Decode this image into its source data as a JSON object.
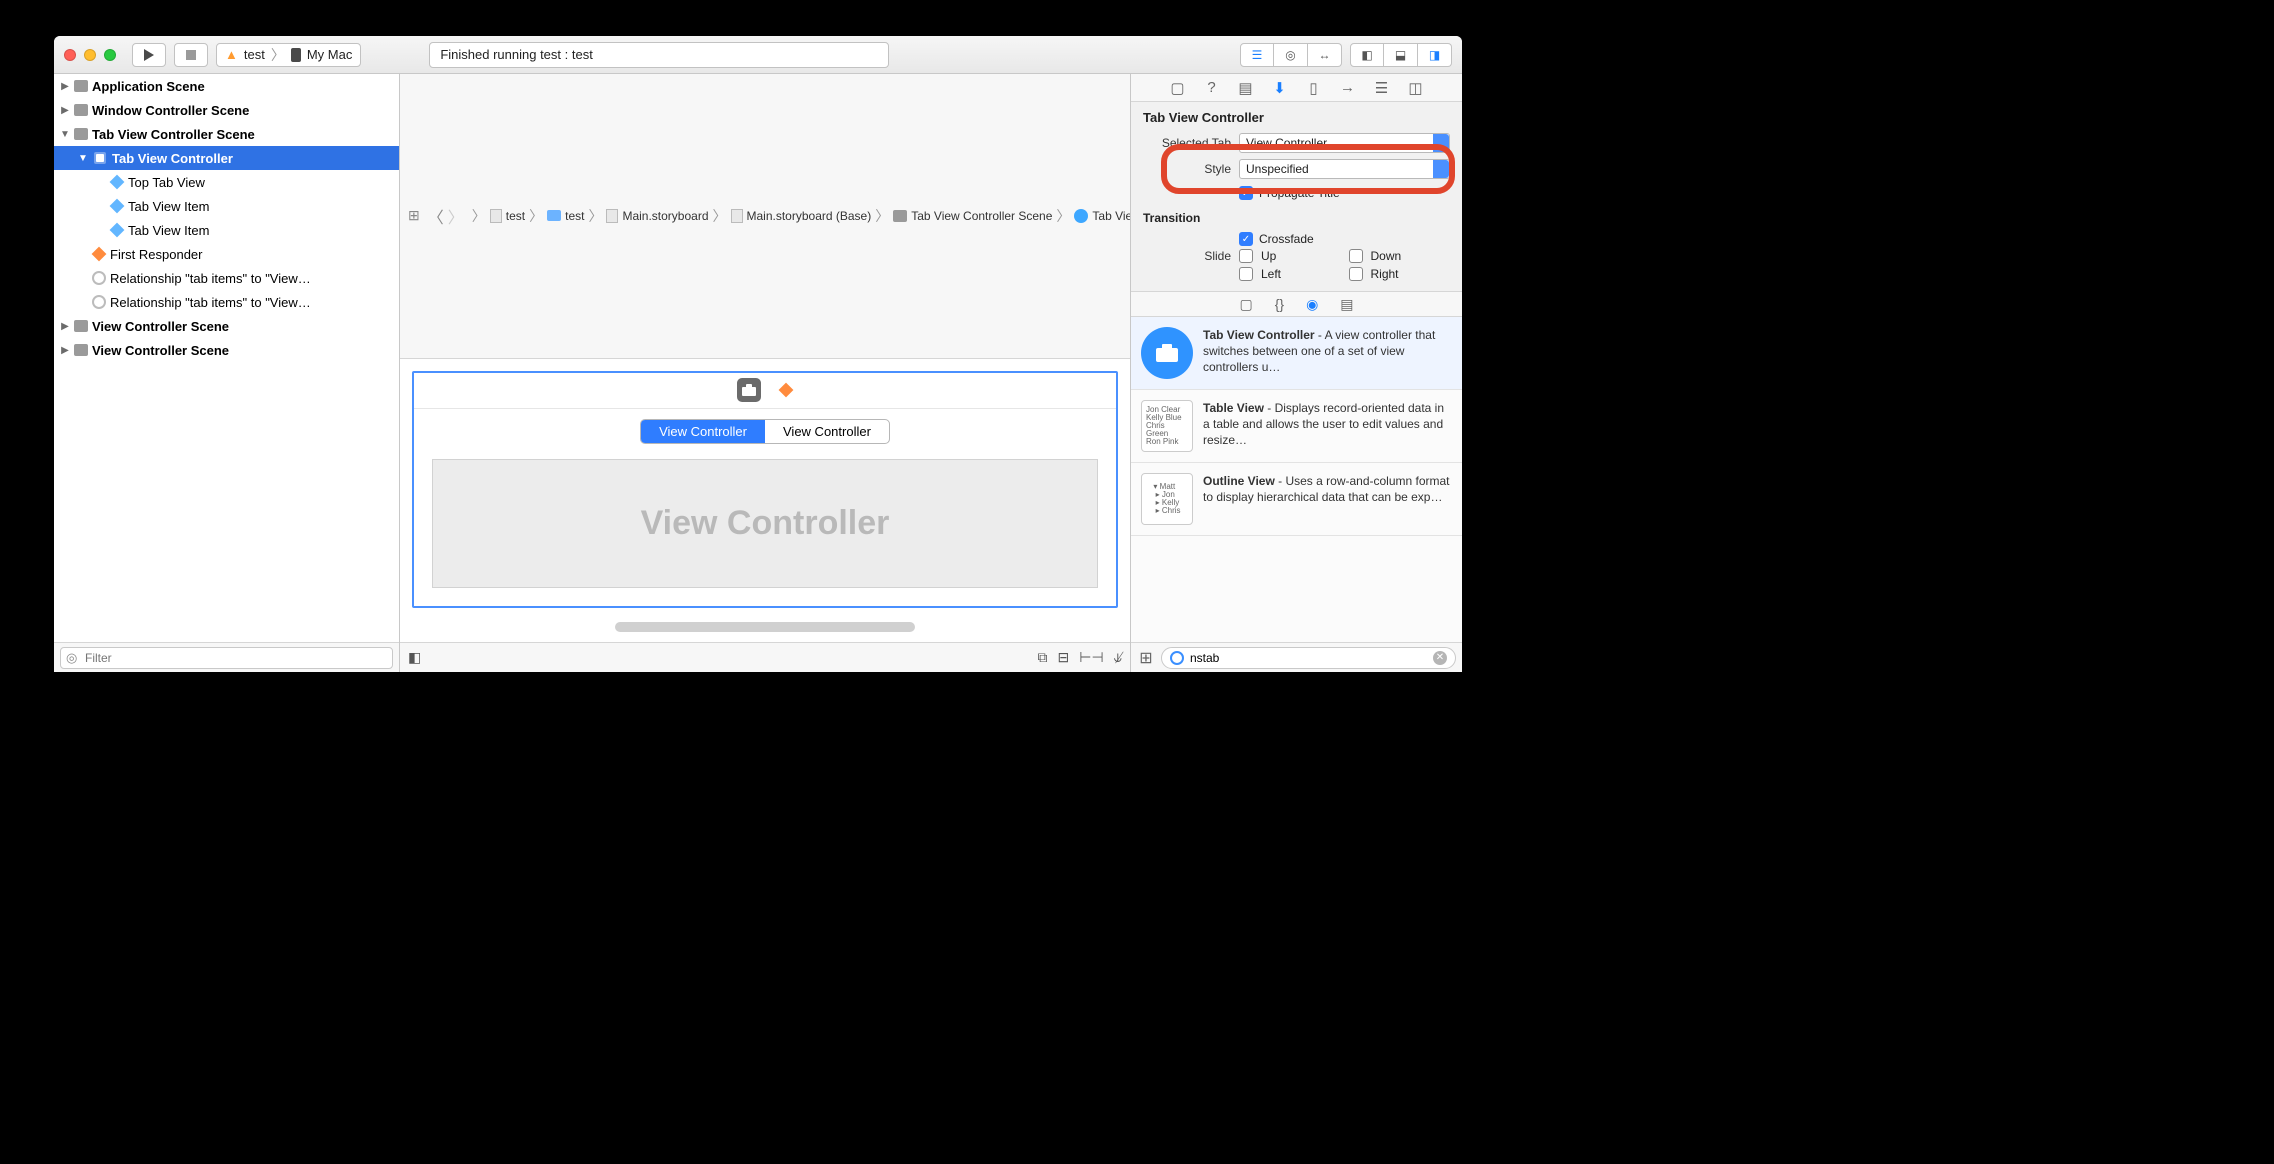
{
  "toolbar": {
    "scheme_app": "test",
    "scheme_device": "My Mac",
    "status": "Finished running test : test"
  },
  "breadcrumb": [
    {
      "icon": "grid",
      "label": ""
    },
    {
      "icon": "file",
      "label": "test"
    },
    {
      "icon": "folder",
      "label": "test"
    },
    {
      "icon": "file",
      "label": "Main.storyboard"
    },
    {
      "icon": "file",
      "label": "Main.storyboard (Base)"
    },
    {
      "icon": "scene",
      "label": "Tab View Controller Scene"
    },
    {
      "icon": "vc",
      "label": "Tab View Controller"
    }
  ],
  "outline": [
    {
      "depth": 0,
      "disclosure": "▶",
      "icon": "scene",
      "label": "Application Scene",
      "bold": true
    },
    {
      "depth": 0,
      "disclosure": "▶",
      "icon": "scene",
      "label": "Window Controller Scene",
      "bold": true
    },
    {
      "depth": 0,
      "disclosure": "▼",
      "icon": "scene",
      "label": "Tab View Controller Scene",
      "bold": true
    },
    {
      "depth": 1,
      "disclosure": "▼",
      "icon": "vc",
      "label": "Tab View Controller",
      "bold": true,
      "selected": true
    },
    {
      "depth": 2,
      "disclosure": "",
      "icon": "cube",
      "label": "Top Tab View"
    },
    {
      "depth": 2,
      "disclosure": "",
      "icon": "cube",
      "label": "Tab View Item"
    },
    {
      "depth": 2,
      "disclosure": "",
      "icon": "cube",
      "label": "Tab View Item"
    },
    {
      "depth": 1,
      "disclosure": "",
      "icon": "cube-o",
      "label": "First Responder"
    },
    {
      "depth": 1,
      "disclosure": "",
      "icon": "rel",
      "label": "Relationship \"tab items\" to \"View…"
    },
    {
      "depth": 1,
      "disclosure": "",
      "icon": "rel",
      "label": "Relationship \"tab items\" to \"View…"
    },
    {
      "depth": 0,
      "disclosure": "▶",
      "icon": "scene",
      "label": "View Controller Scene",
      "bold": true
    },
    {
      "depth": 0,
      "disclosure": "▶",
      "icon": "scene",
      "label": "View Controller Scene",
      "bold": true
    }
  ],
  "filter_placeholder": "Filter",
  "canvas": {
    "tabs": [
      "View Controller",
      "View Controller"
    ],
    "active_tab": 0,
    "body_label": "View Controller"
  },
  "inspector": {
    "title": "Tab View Controller",
    "selected_tab_label": "Selected Tab",
    "selected_tab_value": "View Controller",
    "style_label": "Style",
    "style_value": "Unspecified",
    "propagate_label": "Propagate Title",
    "transition_header": "Transition",
    "crossfade_label": "Crossfade",
    "slide_label": "Slide",
    "slide_opts": [
      "Up",
      "Down",
      "Left",
      "Right"
    ]
  },
  "library": {
    "items": [
      {
        "kind": "circle",
        "title": "Tab View Controller",
        "desc": " - A view controller that switches between one of a set of view controllers u…",
        "selected": true
      },
      {
        "kind": "table",
        "title": "Table View",
        "desc": " - Displays record-oriented data in a table and allows the user to edit values and resize…"
      },
      {
        "kind": "outline",
        "title": "Outline View",
        "desc": " - Uses a row-and-column format to display hierarchical data that can be exp…"
      }
    ],
    "search_value": "nstab"
  }
}
